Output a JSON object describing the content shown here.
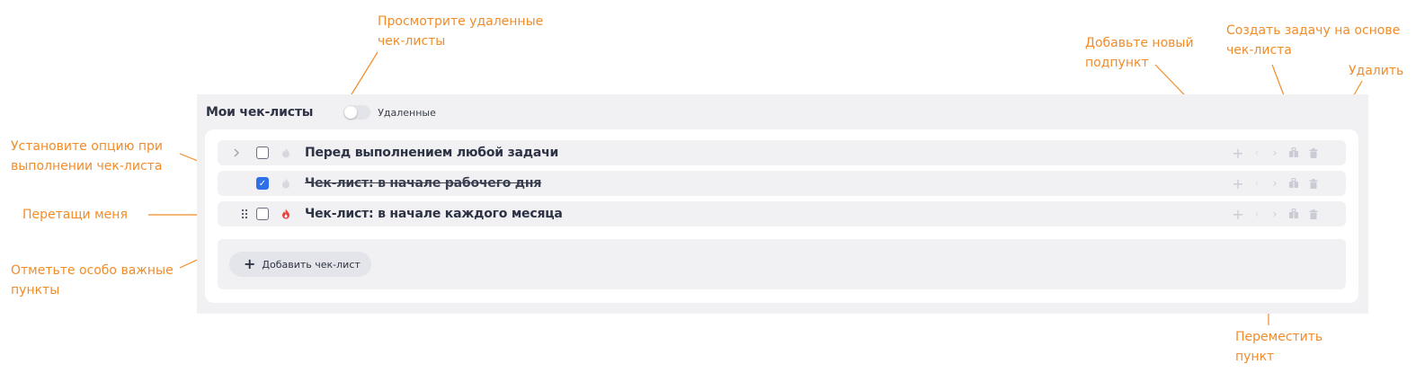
{
  "panel": {
    "title": "Мои чек-листы",
    "toggle_label": "Удаленные",
    "toggle_on": false
  },
  "checklists": [
    {
      "title": "Перед выполнением любой задачи",
      "checked": false,
      "important": false,
      "expandable": true
    },
    {
      "title": "Чек-лист: в начале рабочего дня",
      "checked": true,
      "important": false,
      "expandable": false
    },
    {
      "title": "Чек-лист: в начале каждого месяца",
      "checked": false,
      "important": true,
      "expandable": false
    }
  ],
  "add_button_label": "Добавить чек-лист",
  "annotations": {
    "view_deleted": "Просмотрите удаленные\nчек-листы",
    "add_subitem": "Добавьте новый\nподпункт",
    "create_task": "Создать задачу на основе\nчек-листа",
    "delete": "Удалить",
    "set_option": "Установите опцию при\nвыполнении чек-листа",
    "drag_me": "Перетащи меня",
    "mark_important": "Отметьте особо важные\nпункты",
    "move_item": "Переместить\nпункт"
  },
  "colors": {
    "annotation": "#f28c28",
    "accent": "#2f6fe8",
    "important": "#e8413a",
    "text": "#2d3344"
  },
  "icons": {
    "expand": "chevron-right-icon",
    "drag": "drag-handle-icon",
    "important": "flame-icon",
    "add": "plus-icon",
    "move_up": "chevron-left-icon",
    "move_down": "chevron-right-icon",
    "create_task": "task-icon",
    "delete": "trash-icon"
  }
}
